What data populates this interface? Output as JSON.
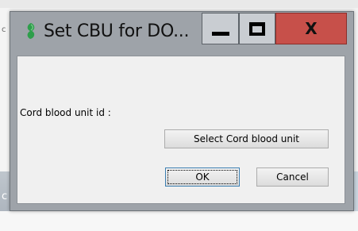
{
  "window": {
    "title": "Set CBU for DO...",
    "controls": {
      "minimize": "minimize-icon",
      "maximize": "maximize-icon",
      "close": "X"
    },
    "app_icon": "app-leaf-icon"
  },
  "form": {
    "cbu_label": "Cord blood unit id :",
    "select_button": "Select Cord blood unit"
  },
  "actions": {
    "ok": "OK",
    "cancel": "Cancel"
  },
  "background": {
    "left_fragment": "c",
    "band_fragment": "c"
  },
  "colors": {
    "close_button": "#c7504a",
    "window_frame": "#9ea3a9",
    "client_area": "#f0f0f0",
    "app_icon": "#2e9e4b"
  }
}
